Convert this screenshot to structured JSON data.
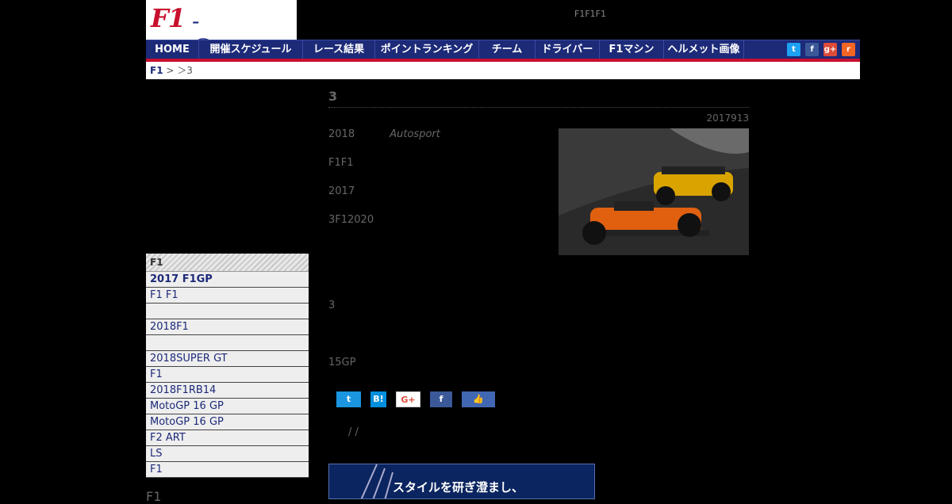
{
  "header": {
    "logo_f1": "F1",
    "logo_rest": "-Gate.com",
    "tagline": "F1F1F1"
  },
  "nav": {
    "items": [
      "HOME",
      "開催スケジュール",
      "レース結果",
      "ポイントランキング",
      "チーム",
      "ドライバー",
      "F1マシン",
      "ヘルメット画像"
    ],
    "icons": [
      "twitter-icon",
      "facebook-icon",
      "google-plus-icon",
      "rss-icon"
    ],
    "icon_glyphs": {
      "twitter": "t",
      "facebook": "f",
      "google": "g+",
      "rss": "r"
    }
  },
  "breadcrumb": {
    "root": "F1",
    "rest": " > ＞3"
  },
  "article": {
    "title": "3",
    "date": "2017913",
    "paragraphs": [
      {
        "text": "2018",
        "source": "Autosport"
      },
      {
        "text": "F1F1"
      },
      {
        "text": "2017"
      },
      {
        "text": "3F12020"
      },
      {
        "text": "3"
      },
      {
        "text": "15GP"
      }
    ],
    "footer_links": "/ /"
  },
  "share": {
    "twitter": "t",
    "hatena": "B!",
    "google": "G+",
    "facebook": "f",
    "like": "👍"
  },
  "sidebar": {
    "head1": "F1",
    "items": [
      "2017 F1GP",
      "F1 F1",
      "",
      "2018F1",
      "",
      " 2018SUPER GT",
      "F1",
      "2018F1RB14",
      "MotoGP 16 GP",
      "MotoGP 16 GP",
      "F2 ART",
      "LS",
      " F1"
    ],
    "head2": "F1"
  },
  "ad": {
    "text": "スタイルを研ぎ澄まし、"
  },
  "colors": {
    "nav_bg": "#1c2a78",
    "accent_red": "#c8102e",
    "background": "#000000"
  }
}
